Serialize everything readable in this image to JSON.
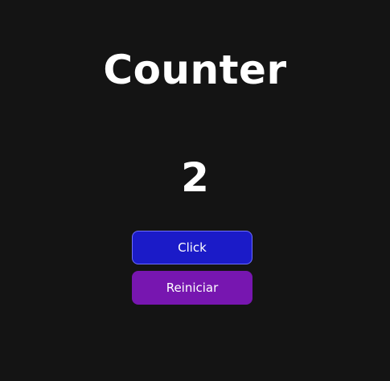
{
  "app": {
    "title": "Counter",
    "count": "2"
  },
  "buttons": {
    "click_label": "Click",
    "reset_label": "Reiniciar"
  },
  "colors": {
    "background": "#141414",
    "click_button": "#1b1bc8",
    "click_button_border": "#6d6dff",
    "reset_button": "#7716b0",
    "text": "#ffffff"
  }
}
